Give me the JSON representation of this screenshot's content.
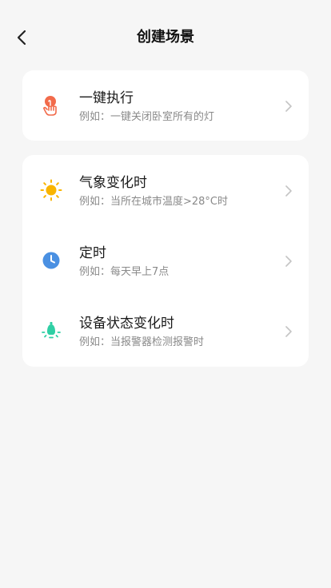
{
  "header": {
    "title": "创建场景",
    "back_icon": "chevron-left-icon"
  },
  "manual": {
    "title": "一键执行",
    "subtitle": "例如：一键关闭卧室所有的灯",
    "icon": "tap-hand-icon",
    "icon_color": "#f26b4b"
  },
  "auto": [
    {
      "title": "气象变化时",
      "subtitle": "例如：当所在城市温度>28°C时",
      "icon": "sun-icon",
      "icon_color": "#f9b400"
    },
    {
      "title": "定时",
      "subtitle": "例如：每天早上7点",
      "icon": "clock-icon",
      "icon_color": "#4a90e2"
    },
    {
      "title": "设备状态变化时",
      "subtitle": "例如：当报警器检测报警时",
      "icon": "device-bulb-icon",
      "icon_color": "#2fcfa4"
    }
  ]
}
